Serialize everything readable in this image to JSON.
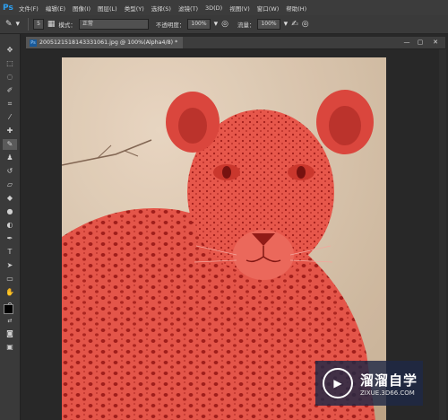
{
  "app": {
    "logo": "Ps"
  },
  "menu": [
    "文件(F)",
    "编辑(E)",
    "图像(I)",
    "图层(L)",
    "类型(Y)",
    "选择(S)",
    "滤镜(T)",
    "3D(D)",
    "视图(V)",
    "窗口(W)",
    "帮助(H)"
  ],
  "options": {
    "brush_size": "5",
    "mode_label": "模式：",
    "mode_value": "正常",
    "opacity_label": "不透明度：",
    "opacity_value": "100%",
    "flow_label": "流量：",
    "flow_value": "100%"
  },
  "document": {
    "tab_title": "2005121518143331061.jpg @ 100%(Alpha4/8) *",
    "ps_badge": "Ps"
  },
  "watermark": {
    "title": "溜溜自学",
    "url": "ZIXUE.3D66.COM"
  },
  "colors": {
    "overlay": "#e8463a",
    "menubar": "#3c3c3c",
    "toolbar": "#3a3a3a",
    "canvas_bg": "#282828"
  }
}
